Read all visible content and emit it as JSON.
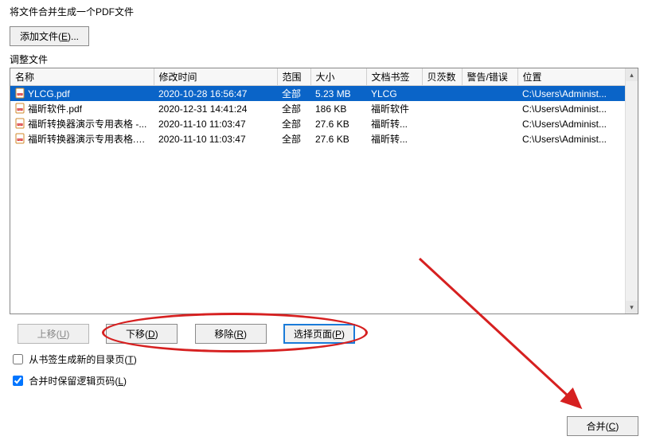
{
  "title": "将文件合并生成一个PDF文件",
  "buttons": {
    "add_file": "添加文件(E)...",
    "move_up": "上移(U)",
    "move_down": "下移(D)",
    "remove": "移除(R)",
    "select_pages": "选择页面(P)",
    "merge": "合并(C)"
  },
  "section_label": "调整文件",
  "columns": {
    "name": "名称",
    "modified": "修改时间",
    "range": "范围",
    "size": "大小",
    "bookmark": "文档书签",
    "pages": "贝茨数",
    "warn": "警告/错误",
    "location": "位置"
  },
  "rows": [
    {
      "selected": true,
      "name": "YLCG.pdf",
      "modified": "2020-10-28 16:56:47",
      "range": "全部",
      "size": "5.23 MB",
      "bookmark": "YLCG",
      "pages": "",
      "warn": "",
      "location": "C:\\Users\\Administ..."
    },
    {
      "selected": false,
      "name": "福昕软件.pdf",
      "modified": "2020-12-31 14:41:24",
      "range": "全部",
      "size": "186 KB",
      "bookmark": "福昕软件",
      "pages": "",
      "warn": "",
      "location": "C:\\Users\\Administ..."
    },
    {
      "selected": false,
      "name": "福昕转换器演示专用表格 -...",
      "modified": "2020-11-10 11:03:47",
      "range": "全部",
      "size": "27.6 KB",
      "bookmark": "福昕转...",
      "pages": "",
      "warn": "",
      "location": "C:\\Users\\Administ..."
    },
    {
      "selected": false,
      "name": "福昕转换器演示专用表格.pdf",
      "modified": "2020-11-10 11:03:47",
      "range": "全部",
      "size": "27.6 KB",
      "bookmark": "福昕转...",
      "pages": "",
      "warn": "",
      "location": "C:\\Users\\Administ..."
    }
  ],
  "checkboxes": {
    "toc_from_bookmark": "从书签生成新的目录页(T)",
    "toc_checked": false,
    "keep_logical_page": "合并时保留逻辑页码(L)",
    "keep_checked": true
  }
}
